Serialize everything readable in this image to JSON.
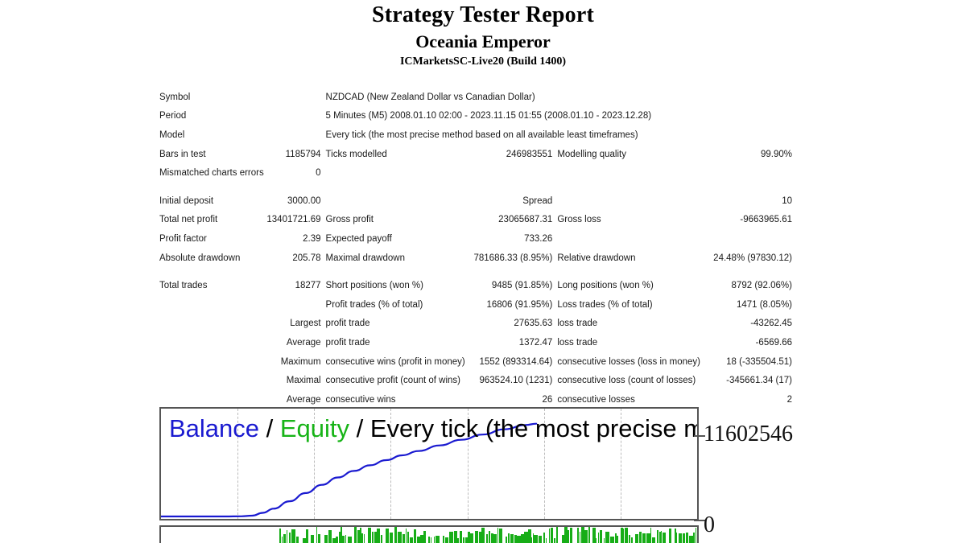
{
  "header": {
    "title": "Strategy Tester Report",
    "ea_name": "Oceania Emperor",
    "server": "ICMarketsSC-Live20 (Build 1400)"
  },
  "settings": {
    "symbol_label": "Symbol",
    "symbol_value": "NZDCAD (New Zealand Dollar vs Canadian Dollar)",
    "period_label": "Period",
    "period_value": "5 Minutes (M5) 2008.01.10 02:00 - 2023.11.15 01:55 (2008.01.10 - 2023.12.28)",
    "model_label": "Model",
    "model_value": "Every tick (the most precise method based on all available least timeframes)",
    "bars_label": "Bars in test",
    "bars_value": "1185794",
    "ticks_label": "Ticks modelled",
    "ticks_value": "246983551",
    "quality_label": "Modelling quality",
    "quality_value": "99.90%",
    "mismatch_label": "Mismatched charts errors",
    "mismatch_value": "0"
  },
  "money": {
    "initial_deposit_label": "Initial deposit",
    "initial_deposit_value": "3000.00",
    "spread_label": "Spread",
    "spread_value": "10",
    "net_profit_label": "Total net profit",
    "net_profit_value": "13401721.69",
    "gross_profit_label": "Gross profit",
    "gross_profit_value": "23065687.31",
    "gross_loss_label": "Gross loss",
    "gross_loss_value": "-9663965.61",
    "profit_factor_label": "Profit factor",
    "profit_factor_value": "2.39",
    "expected_payoff_label": "Expected payoff",
    "expected_payoff_value": "733.26",
    "abs_drawdown_label": "Absolute drawdown",
    "abs_drawdown_value": "205.78",
    "max_drawdown_label": "Maximal drawdown",
    "max_drawdown_value": "781686.33 (8.95%)",
    "rel_drawdown_label": "Relative drawdown",
    "rel_drawdown_value": "24.48% (97830.12)"
  },
  "trades": {
    "total_trades_label": "Total trades",
    "total_trades_value": "18277",
    "short_label": "Short positions (won %)",
    "short_value": "9485 (91.85%)",
    "long_label": "Long positions (won %)",
    "long_value": "8792 (92.06%)",
    "profit_trades_label": "Profit trades (% of total)",
    "profit_trades_value": "16806 (91.95%)",
    "loss_trades_label": "Loss trades (% of total)",
    "loss_trades_value": "1471 (8.05%)",
    "largest_label": "Largest",
    "largest_profit_label": "profit trade",
    "largest_profit_value": "27635.63",
    "largest_loss_label": "loss trade",
    "largest_loss_value": "-43262.45",
    "average_label": "Average",
    "average_profit_label": "profit trade",
    "average_profit_value": "1372.47",
    "average_loss_label": "loss trade",
    "average_loss_value": "-6569.66",
    "maximum_label": "Maximum",
    "max_cons_wins_label": "consecutive wins (profit in money)",
    "max_cons_wins_value": "1552 (893314.64)",
    "max_cons_losses_label": "consecutive losses (loss in money)",
    "max_cons_losses_value": "18 (-335504.51)",
    "maximal_label": "Maximal",
    "maximal_cons_profit_label": "consecutive profit (count of wins)",
    "maximal_cons_profit_value": "963524.10 (1231)",
    "maximal_cons_loss_label": "consecutive loss (count of losses)",
    "maximal_cons_loss_value": "-345661.34 (17)",
    "average2_label": "Average",
    "avg_cons_wins_label": "consecutive wins",
    "avg_cons_wins_value": "26",
    "avg_cons_losses_label": "consecutive losses",
    "avg_cons_losses_value": "2"
  },
  "chart": {
    "legend_balance": "Balance",
    "legend_sep1": " / ",
    "legend_equity": "Equity",
    "legend_rest": " / Every tick (the most precise method",
    "axis_max_label": "11602546",
    "axis_min_label": "0",
    "colors": {
      "balance": "#1a1ad0",
      "equity": "#17b417",
      "lots": "#17ad17",
      "frame": "#555555",
      "grid": "#bcbcbc"
    }
  },
  "chart_data": {
    "type": "line",
    "title": "Balance / Equity / Every tick (the most precise method",
    "xlabel": "",
    "ylabel": "",
    "ylim": [
      0,
      11602546
    ],
    "grid": true,
    "legend_position": "top-left",
    "series": [
      {
        "name": "Balance",
        "color": "#1a1ad0",
        "x": [
          0,
          4,
          8,
          12,
          15,
          17,
          19,
          21,
          24,
          27,
          30,
          33,
          36,
          39,
          42,
          45,
          48,
          52,
          56,
          60,
          64,
          68,
          70
        ],
        "y": [
          3000,
          3000,
          3000,
          3000,
          20000,
          90000,
          420000,
          900000,
          1750000,
          2700000,
          3650000,
          4500000,
          5250000,
          5900000,
          6500000,
          7050000,
          7550000,
          8200000,
          8850000,
          9450000,
          10050000,
          10550000,
          10700000
        ]
      }
    ],
    "lots_histogram": {
      "name": "Lots",
      "color": "#17ad17",
      "start_x_pct": 22,
      "end_x_pct": 100
    }
  }
}
